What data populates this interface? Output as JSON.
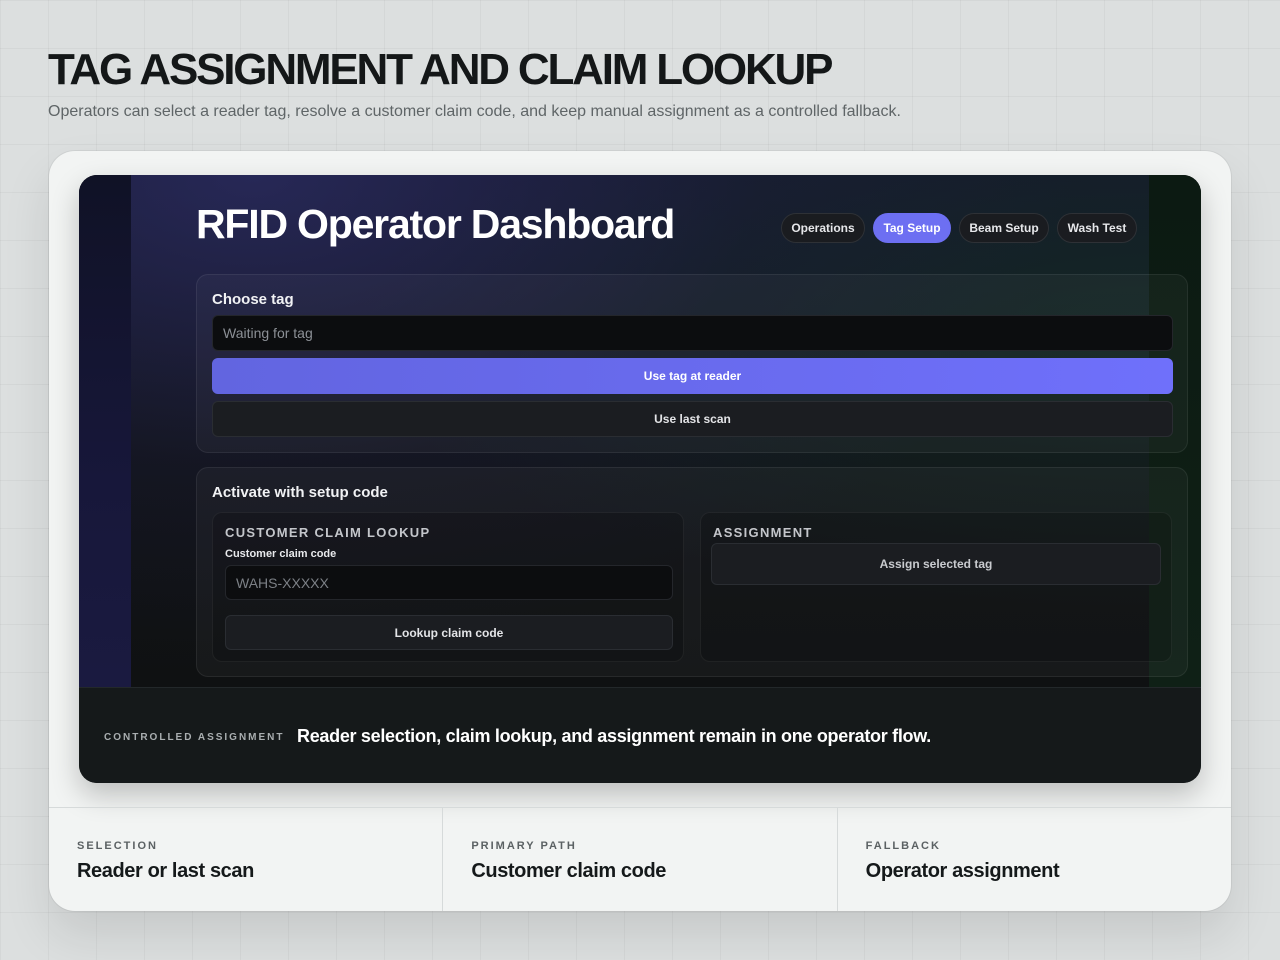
{
  "header": {
    "title": "TAG ASSIGNMENT AND CLAIM LOOKUP",
    "subtitle": "Operators can select a reader tag, resolve a customer claim code, and keep manual assignment as a controlled fallback."
  },
  "app": {
    "title": "RFID Operator Dashboard",
    "nav": [
      {
        "label": "Operations",
        "active": false
      },
      {
        "label": "Tag Setup",
        "active": true
      },
      {
        "label": "Beam Setup",
        "active": false
      },
      {
        "label": "Wash Test",
        "active": false
      }
    ],
    "choose_tag": {
      "title": "Choose tag",
      "input_placeholder": "Waiting for tag",
      "use_reader_label": "Use tag at reader",
      "use_last_scan_label": "Use last scan"
    },
    "activate": {
      "title": "Activate with setup code",
      "claim_lookup": {
        "heading": "CUSTOMER CLAIM LOOKUP",
        "field_label": "Customer claim code",
        "input_placeholder": "WAHS-XXXXX",
        "button_label": "Lookup claim code"
      },
      "assignment": {
        "heading": "ASSIGNMENT",
        "button_label": "Assign selected tag"
      }
    }
  },
  "caption": {
    "tag": "CONTROLLED ASSIGNMENT",
    "text": "Reader selection, claim lookup, and assignment remain in one operator flow."
  },
  "stats": [
    {
      "label": "SELECTION",
      "value": "Reader or last scan"
    },
    {
      "label": "PRIMARY PATH",
      "value": "Customer claim code"
    },
    {
      "label": "FALLBACK",
      "value": "Operator assignment"
    }
  ],
  "colors": {
    "accent": "#6d6ff2",
    "page_background": "#dcdfdf",
    "app_background": "#0b0d10"
  }
}
